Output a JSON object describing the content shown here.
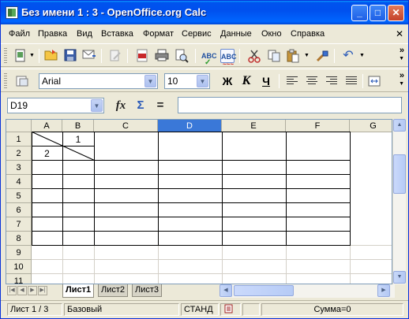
{
  "window": {
    "title": "Без имени 1 : 3 - OpenOffice.org Calc",
    "minimize_label": "_",
    "maximize_label": "□",
    "close_label": "✕"
  },
  "menu": {
    "items": [
      "Файл",
      "Правка",
      "Вид",
      "Вставка",
      "Формат",
      "Сервис",
      "Данные",
      "Окно",
      "Справка"
    ],
    "doc_close_label": "✕"
  },
  "toolbar": {
    "overflow_label": "»"
  },
  "format_toolbar": {
    "font_name": "Arial",
    "font_size": "10",
    "bold_label": "Ж",
    "italic_label": "К",
    "underline_label": "Ч"
  },
  "formula_bar": {
    "cell_ref": "D19",
    "function_wizard_label": "fx",
    "sum_label": "Σ",
    "equals_label": "=",
    "formula_value": ""
  },
  "sheet": {
    "columns": [
      "A",
      "B",
      "C",
      "D",
      "E",
      "F",
      "G"
    ],
    "selected_column": "D",
    "rows": [
      "1",
      "2",
      "3",
      "4",
      "5",
      "6",
      "7",
      "8",
      "9",
      "10",
      "11"
    ],
    "cells": {
      "B1": "1",
      "A2": "2"
    }
  },
  "tabs": [
    "Лист1",
    "Лист2",
    "Лист3"
  ],
  "active_tab": "Лист1",
  "status": {
    "sheet_info": "Лист 1 / 3",
    "page_style": "Базовый",
    "mode": "СТАНД",
    "sum": "Сумма=0"
  }
}
